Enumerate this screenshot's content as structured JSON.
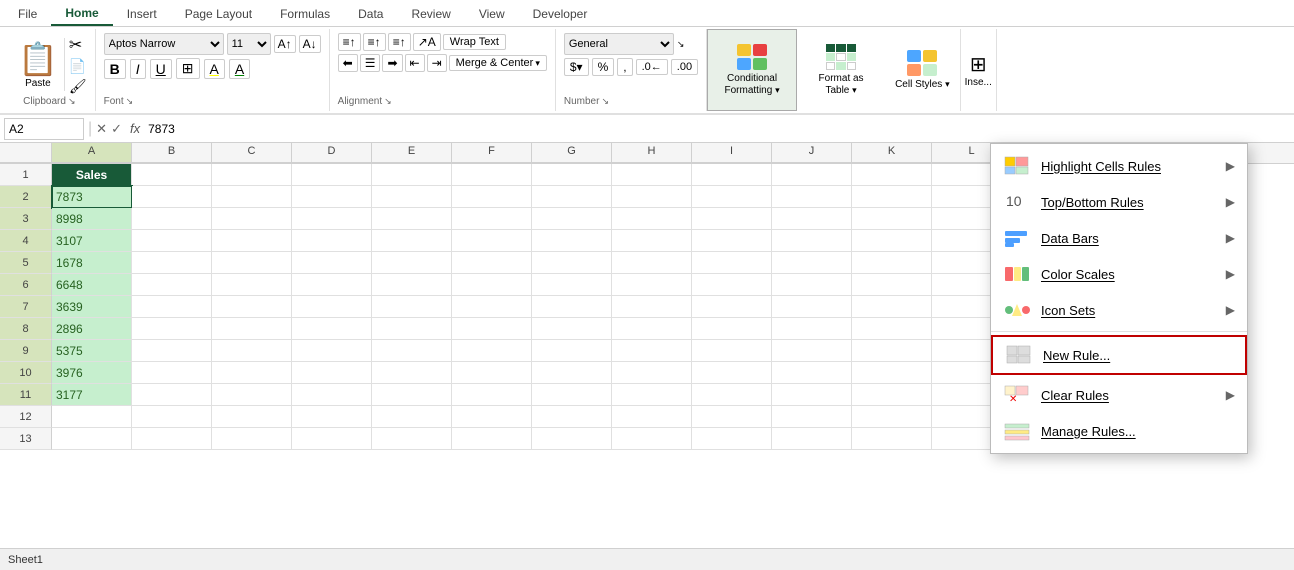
{
  "tabs": {
    "items": [
      "File",
      "Home",
      "Insert",
      "Page Layout",
      "Formulas",
      "Data",
      "Review",
      "View",
      "Developer"
    ],
    "active": "Home"
  },
  "ribbon": {
    "clipboard": {
      "label": "Clipboard",
      "paste_label": "Paste",
      "expand_icon": "⌄"
    },
    "font": {
      "label": "Font",
      "font_name": "Aptos Narrow",
      "font_size": "11",
      "bold": "B",
      "italic": "I",
      "underline": "U",
      "expand_icon": "⌄"
    },
    "alignment": {
      "label": "Alignment",
      "wrap_text": "Wrap Text",
      "merge_center": "Merge & Center",
      "expand_icon": "⌄"
    },
    "number": {
      "label": "Number",
      "format": "General",
      "expand_icon": "⌄"
    },
    "styles": {
      "conditional_formatting": "Conditional Formatting",
      "format_as_table": "Format as Table",
      "cell_styles": "Cell Styles"
    }
  },
  "formula_bar": {
    "cell_ref": "A2",
    "value": "7873",
    "fx": "fx"
  },
  "columns": [
    "A",
    "B",
    "C",
    "D",
    "E",
    "F",
    "G",
    "H",
    "I",
    "J",
    "K",
    "L"
  ],
  "rows": [
    {
      "id": 1,
      "cells": [
        {
          "value": "Sales",
          "type": "header"
        },
        {
          "value": "",
          "type": "empty"
        },
        {
          "value": "",
          "type": "empty"
        },
        {
          "value": "",
          "type": "empty"
        },
        {
          "value": "",
          "type": "empty"
        },
        {
          "value": "",
          "type": "empty"
        },
        {
          "value": "",
          "type": "empty"
        },
        {
          "value": "",
          "type": "empty"
        },
        {
          "value": "",
          "type": "empty"
        },
        {
          "value": "",
          "type": "empty"
        },
        {
          "value": "",
          "type": "empty"
        },
        {
          "value": "",
          "type": "empty"
        }
      ]
    },
    {
      "id": 2,
      "cells": [
        {
          "value": "7873",
          "type": "data",
          "active": true
        },
        {
          "value": "",
          "type": "empty"
        },
        {
          "value": "",
          "type": "empty"
        },
        {
          "value": "",
          "type": "empty"
        },
        {
          "value": "",
          "type": "empty"
        },
        {
          "value": "",
          "type": "empty"
        },
        {
          "value": "",
          "type": "empty"
        },
        {
          "value": "",
          "type": "empty"
        },
        {
          "value": "",
          "type": "empty"
        },
        {
          "value": "",
          "type": "empty"
        },
        {
          "value": "",
          "type": "empty"
        },
        {
          "value": "",
          "type": "empty"
        }
      ]
    },
    {
      "id": 3,
      "cells": [
        {
          "value": "8998",
          "type": "data"
        },
        {
          "value": "",
          "type": "empty"
        },
        {
          "value": "",
          "type": "empty"
        },
        {
          "value": "",
          "type": "empty"
        },
        {
          "value": "",
          "type": "empty"
        },
        {
          "value": "",
          "type": "empty"
        },
        {
          "value": "",
          "type": "empty"
        },
        {
          "value": "",
          "type": "empty"
        },
        {
          "value": "",
          "type": "empty"
        },
        {
          "value": "",
          "type": "empty"
        },
        {
          "value": "",
          "type": "empty"
        },
        {
          "value": "",
          "type": "empty"
        }
      ]
    },
    {
      "id": 4,
      "cells": [
        {
          "value": "3107",
          "type": "data"
        },
        {
          "value": "",
          "type": "empty"
        },
        {
          "value": "",
          "type": "empty"
        },
        {
          "value": "",
          "type": "empty"
        },
        {
          "value": "",
          "type": "empty"
        },
        {
          "value": "",
          "type": "empty"
        },
        {
          "value": "",
          "type": "empty"
        },
        {
          "value": "",
          "type": "empty"
        },
        {
          "value": "",
          "type": "empty"
        },
        {
          "value": "",
          "type": "empty"
        },
        {
          "value": "",
          "type": "empty"
        },
        {
          "value": "",
          "type": "empty"
        }
      ]
    },
    {
      "id": 5,
      "cells": [
        {
          "value": "1678",
          "type": "data"
        },
        {
          "value": "",
          "type": "empty"
        },
        {
          "value": "",
          "type": "empty"
        },
        {
          "value": "",
          "type": "empty"
        },
        {
          "value": "",
          "type": "empty"
        },
        {
          "value": "",
          "type": "empty"
        },
        {
          "value": "",
          "type": "empty"
        },
        {
          "value": "",
          "type": "empty"
        },
        {
          "value": "",
          "type": "empty"
        },
        {
          "value": "",
          "type": "empty"
        },
        {
          "value": "",
          "type": "empty"
        },
        {
          "value": "",
          "type": "empty"
        }
      ]
    },
    {
      "id": 6,
      "cells": [
        {
          "value": "6648",
          "type": "data"
        },
        {
          "value": "",
          "type": "empty"
        },
        {
          "value": "",
          "type": "empty"
        },
        {
          "value": "",
          "type": "empty"
        },
        {
          "value": "",
          "type": "empty"
        },
        {
          "value": "",
          "type": "empty"
        },
        {
          "value": "",
          "type": "empty"
        },
        {
          "value": "",
          "type": "empty"
        },
        {
          "value": "",
          "type": "empty"
        },
        {
          "value": "",
          "type": "empty"
        },
        {
          "value": "",
          "type": "empty"
        },
        {
          "value": "",
          "type": "empty"
        }
      ]
    },
    {
      "id": 7,
      "cells": [
        {
          "value": "3639",
          "type": "data"
        },
        {
          "value": "",
          "type": "empty"
        },
        {
          "value": "",
          "type": "empty"
        },
        {
          "value": "",
          "type": "empty"
        },
        {
          "value": "",
          "type": "empty"
        },
        {
          "value": "",
          "type": "empty"
        },
        {
          "value": "",
          "type": "empty"
        },
        {
          "value": "",
          "type": "empty"
        },
        {
          "value": "",
          "type": "empty"
        },
        {
          "value": "",
          "type": "empty"
        },
        {
          "value": "",
          "type": "empty"
        },
        {
          "value": "",
          "type": "empty"
        }
      ]
    },
    {
      "id": 8,
      "cells": [
        {
          "value": "2896",
          "type": "data"
        },
        {
          "value": "",
          "type": "empty"
        },
        {
          "value": "",
          "type": "empty"
        },
        {
          "value": "",
          "type": "empty"
        },
        {
          "value": "",
          "type": "empty"
        },
        {
          "value": "",
          "type": "empty"
        },
        {
          "value": "",
          "type": "empty"
        },
        {
          "value": "",
          "type": "empty"
        },
        {
          "value": "",
          "type": "empty"
        },
        {
          "value": "",
          "type": "empty"
        },
        {
          "value": "",
          "type": "empty"
        },
        {
          "value": "",
          "type": "empty"
        }
      ]
    },
    {
      "id": 9,
      "cells": [
        {
          "value": "5375",
          "type": "data"
        },
        {
          "value": "",
          "type": "empty"
        },
        {
          "value": "",
          "type": "empty"
        },
        {
          "value": "",
          "type": "empty"
        },
        {
          "value": "",
          "type": "empty"
        },
        {
          "value": "",
          "type": "empty"
        },
        {
          "value": "",
          "type": "empty"
        },
        {
          "value": "",
          "type": "empty"
        },
        {
          "value": "",
          "type": "empty"
        },
        {
          "value": "",
          "type": "empty"
        },
        {
          "value": "",
          "type": "empty"
        },
        {
          "value": "",
          "type": "empty"
        }
      ]
    },
    {
      "id": 10,
      "cells": [
        {
          "value": "3976",
          "type": "data"
        },
        {
          "value": "",
          "type": "empty"
        },
        {
          "value": "",
          "type": "empty"
        },
        {
          "value": "",
          "type": "empty"
        },
        {
          "value": "",
          "type": "empty"
        },
        {
          "value": "",
          "type": "empty"
        },
        {
          "value": "",
          "type": "empty"
        },
        {
          "value": "",
          "type": "empty"
        },
        {
          "value": "",
          "type": "empty"
        },
        {
          "value": "",
          "type": "empty"
        },
        {
          "value": "",
          "type": "empty"
        },
        {
          "value": "",
          "type": "empty"
        }
      ]
    },
    {
      "id": 11,
      "cells": [
        {
          "value": "3177",
          "type": "data"
        },
        {
          "value": "",
          "type": "empty"
        },
        {
          "value": "",
          "type": "empty"
        },
        {
          "value": "",
          "type": "empty"
        },
        {
          "value": "",
          "type": "empty"
        },
        {
          "value": "",
          "type": "empty"
        },
        {
          "value": "",
          "type": "empty"
        },
        {
          "value": "",
          "type": "empty"
        },
        {
          "value": "",
          "type": "empty"
        },
        {
          "value": "",
          "type": "empty"
        },
        {
          "value": "",
          "type": "empty"
        },
        {
          "value": "",
          "type": "empty"
        }
      ]
    },
    {
      "id": 12,
      "cells": [
        {
          "value": "",
          "type": "empty"
        },
        {
          "value": "",
          "type": "empty"
        },
        {
          "value": "",
          "type": "empty"
        },
        {
          "value": "",
          "type": "empty"
        },
        {
          "value": "",
          "type": "empty"
        },
        {
          "value": "",
          "type": "empty"
        },
        {
          "value": "",
          "type": "empty"
        },
        {
          "value": "",
          "type": "empty"
        },
        {
          "value": "",
          "type": "empty"
        },
        {
          "value": "",
          "type": "empty"
        },
        {
          "value": "",
          "type": "empty"
        },
        {
          "value": "",
          "type": "empty"
        }
      ]
    },
    {
      "id": 13,
      "cells": [
        {
          "value": "",
          "type": "empty"
        },
        {
          "value": "",
          "type": "empty"
        },
        {
          "value": "",
          "type": "empty"
        },
        {
          "value": "",
          "type": "empty"
        },
        {
          "value": "",
          "type": "empty"
        },
        {
          "value": "",
          "type": "empty"
        },
        {
          "value": "",
          "type": "empty"
        },
        {
          "value": "",
          "type": "empty"
        },
        {
          "value": "",
          "type": "empty"
        },
        {
          "value": "",
          "type": "empty"
        },
        {
          "value": "",
          "type": "empty"
        },
        {
          "value": "",
          "type": "empty"
        }
      ]
    }
  ],
  "dropdown_menu": {
    "items": [
      {
        "id": "highlight-cells",
        "label": "Highlight Cells Rules",
        "has_arrow": true
      },
      {
        "id": "top-bottom",
        "label": "Top/Bottom Rules",
        "has_arrow": true
      },
      {
        "id": "data-bars",
        "label": "Data Bars",
        "has_arrow": true
      },
      {
        "id": "color-scales",
        "label": "Color Scales",
        "has_arrow": true
      },
      {
        "id": "icon-sets",
        "label": "Icon Sets",
        "has_arrow": true
      },
      {
        "id": "new-rule",
        "label": "New Rule...",
        "has_arrow": false,
        "highlighted": true
      },
      {
        "id": "clear-rules",
        "label": "Clear Rules",
        "has_arrow": true
      },
      {
        "id": "manage-rules",
        "label": "Manage Rules...",
        "has_arrow": false
      }
    ]
  },
  "colors": {
    "green_dark": "#185a38",
    "green_light": "#c6efce",
    "green_text": "#276221",
    "header_bg": "#185a38",
    "selected_col": "#d6e4bc",
    "highlight_border": "#c00000"
  }
}
